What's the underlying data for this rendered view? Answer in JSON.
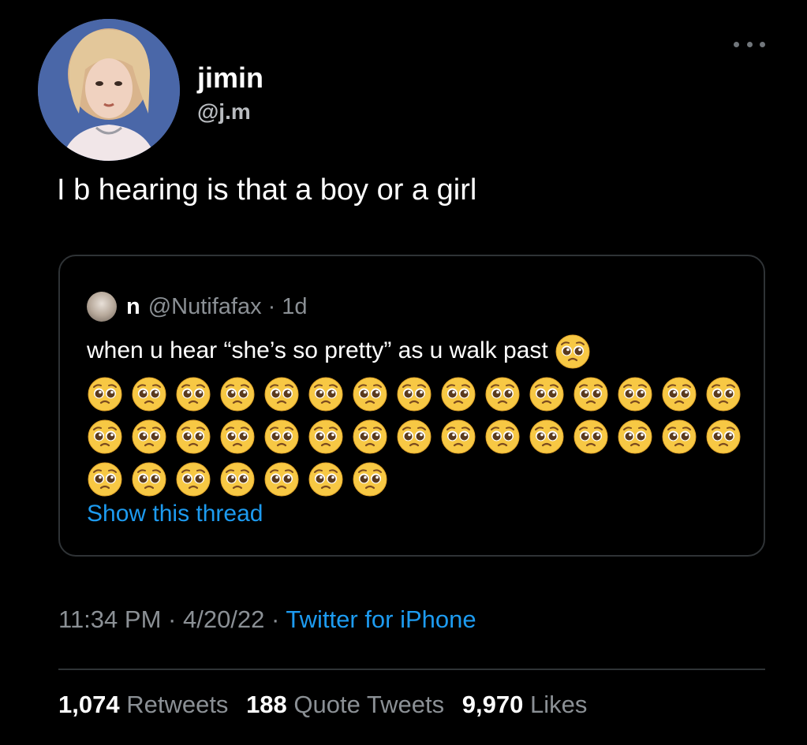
{
  "author": {
    "display_name": "jimin",
    "handle": "@j.m",
    "avatar_icon": "profile-photo"
  },
  "tweet": {
    "text": "I b hearing is that a boy or a girl",
    "more_icon": "ellipsis-icon"
  },
  "quoted_tweet": {
    "name": "n",
    "handle": "@Nutifafax",
    "separator": "·",
    "time": "1d",
    "text": "when u hear “she’s so pretty” as u walk past",
    "emoji_name": "pleading-face-emoji",
    "emoji_count_inline": 1,
    "emoji_rows": [
      15,
      15,
      7
    ],
    "show_thread_label": "Show this thread"
  },
  "meta": {
    "time": "11:34 PM",
    "sep1": "·",
    "date": "4/20/22",
    "sep2": "·",
    "source": "Twitter for iPhone"
  },
  "stats": {
    "retweets_count": "1,074",
    "retweets_label": "Retweets",
    "quotes_count": "188",
    "quotes_label": "Quote Tweets",
    "likes_count": "9,970",
    "likes_label": "Likes"
  },
  "colors": {
    "background": "#000000",
    "text": "#ffffff",
    "secondary": "#8b9095",
    "link": "#1d9bf0",
    "border": "#2f3336"
  }
}
